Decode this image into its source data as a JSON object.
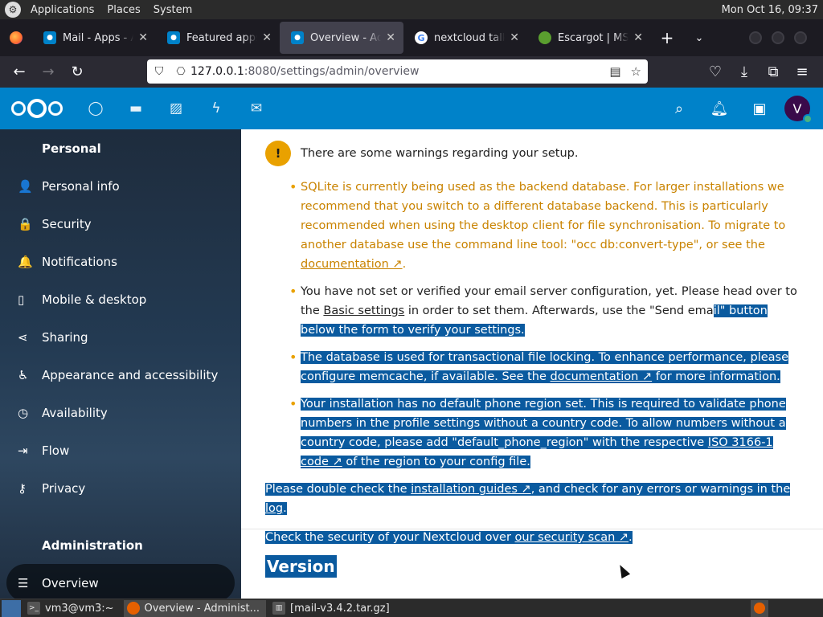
{
  "gnome_panel": {
    "menus": [
      "Applications",
      "Places",
      "System"
    ],
    "clock": "Mon Oct 16, 09:37"
  },
  "browser": {
    "tabs": [
      {
        "title": "Mail - Apps - Ap",
        "favicon": "nextcloud-icon",
        "active": false
      },
      {
        "title": "Featured apps -",
        "favicon": "nextcloud-icon",
        "active": false
      },
      {
        "title": "Overview - Adm",
        "favicon": "nextcloud-icon",
        "active": true
      },
      {
        "title": "nextcloud talk d",
        "favicon": "google-icon",
        "active": false
      },
      {
        "title": "Escargot | MSN",
        "favicon": "escargot-icon",
        "active": false
      }
    ],
    "new_tab": "+",
    "url_host": "127.0.0.1",
    "url_path": ":8080/settings/admin/overview"
  },
  "sidebar": {
    "personal_heading": "Personal",
    "personal_items": [
      {
        "label": "Personal info",
        "icon": "user-icon",
        "glyph": "👤"
      },
      {
        "label": "Security",
        "icon": "lock-icon",
        "glyph": "🔒"
      },
      {
        "label": "Notifications",
        "icon": "bell-icon",
        "glyph": "🔔"
      },
      {
        "label": "Mobile & desktop",
        "icon": "phone-icon",
        "glyph": "▯"
      },
      {
        "label": "Sharing",
        "icon": "share-icon",
        "glyph": "⋖"
      },
      {
        "label": "Appearance and accessibility",
        "icon": "accessibility-icon",
        "glyph": "♿"
      },
      {
        "label": "Availability",
        "icon": "clock-icon",
        "glyph": "◷"
      },
      {
        "label": "Flow",
        "icon": "flow-icon",
        "glyph": "⇥"
      },
      {
        "label": "Privacy",
        "icon": "key-icon",
        "glyph": "⚷"
      }
    ],
    "admin_heading": "Administration",
    "admin_items": [
      {
        "label": "Overview",
        "icon": "list-icon",
        "glyph": "☰",
        "active": true
      }
    ]
  },
  "content": {
    "warning_heading": "There are some warnings regarding your setup.",
    "w1_text": "SQLite is currently being used as the backend database. For larger installations we recommend that you switch to a different database backend. This is particularly recommended when using the desktop client for file synchronisation. To migrate to another database use the command line tool: \"occ db:convert-type\", or see the ",
    "w1_link": "documentation ↗",
    "w1_end": ".",
    "w2_a": "You have not set or verified your email server configuration, yet. Please head over to the ",
    "w2_link": "Basic settings",
    "w2_b": " in order to set them. Afterwards, use the \"Send ema",
    "w2_c": "il\" button below the form to verify your settings.",
    "w3_a": "The database is used for transactional file locking. To enhance performance, please configure memcache, if available. See the ",
    "w3_link": "documentation ↗",
    "w3_b": " for more information.",
    "w4_a": "Your installation has no default phone region set. This is required to validate phone numbers in the profile settings without a country code. To allow numbers without a country code, please add \"default_phone_region\" with the respective ",
    "w4_link": "ISO 3166-1 code ↗",
    "w4_b": " of the region to your config file.",
    "p1_a": "Please double check the ",
    "p1_link1": "installation guides ↗",
    "p1_b": ", and check for any errors or warnings in the ",
    "p1_link2": "log",
    "p1_c": ".",
    "p2_a": "Check the security of your Nextcloud over ",
    "p2_link": "our security scan ↗",
    "p2_b": ".",
    "version_heading": "Version"
  },
  "taskbar": {
    "tasks": [
      {
        "label": "vm3@vm3:~",
        "icon": "terminal-icon"
      },
      {
        "label": "Overview - Administ...",
        "icon": "firefox-icon",
        "active": true
      },
      {
        "label": "[mail-v3.4.2.tar.gz]",
        "icon": "archive-icon"
      }
    ]
  },
  "colors": {
    "nextcloud_blue": "#0082c9",
    "warning_orange": "#e9a100",
    "selection_blue": "#0a5a9f"
  }
}
